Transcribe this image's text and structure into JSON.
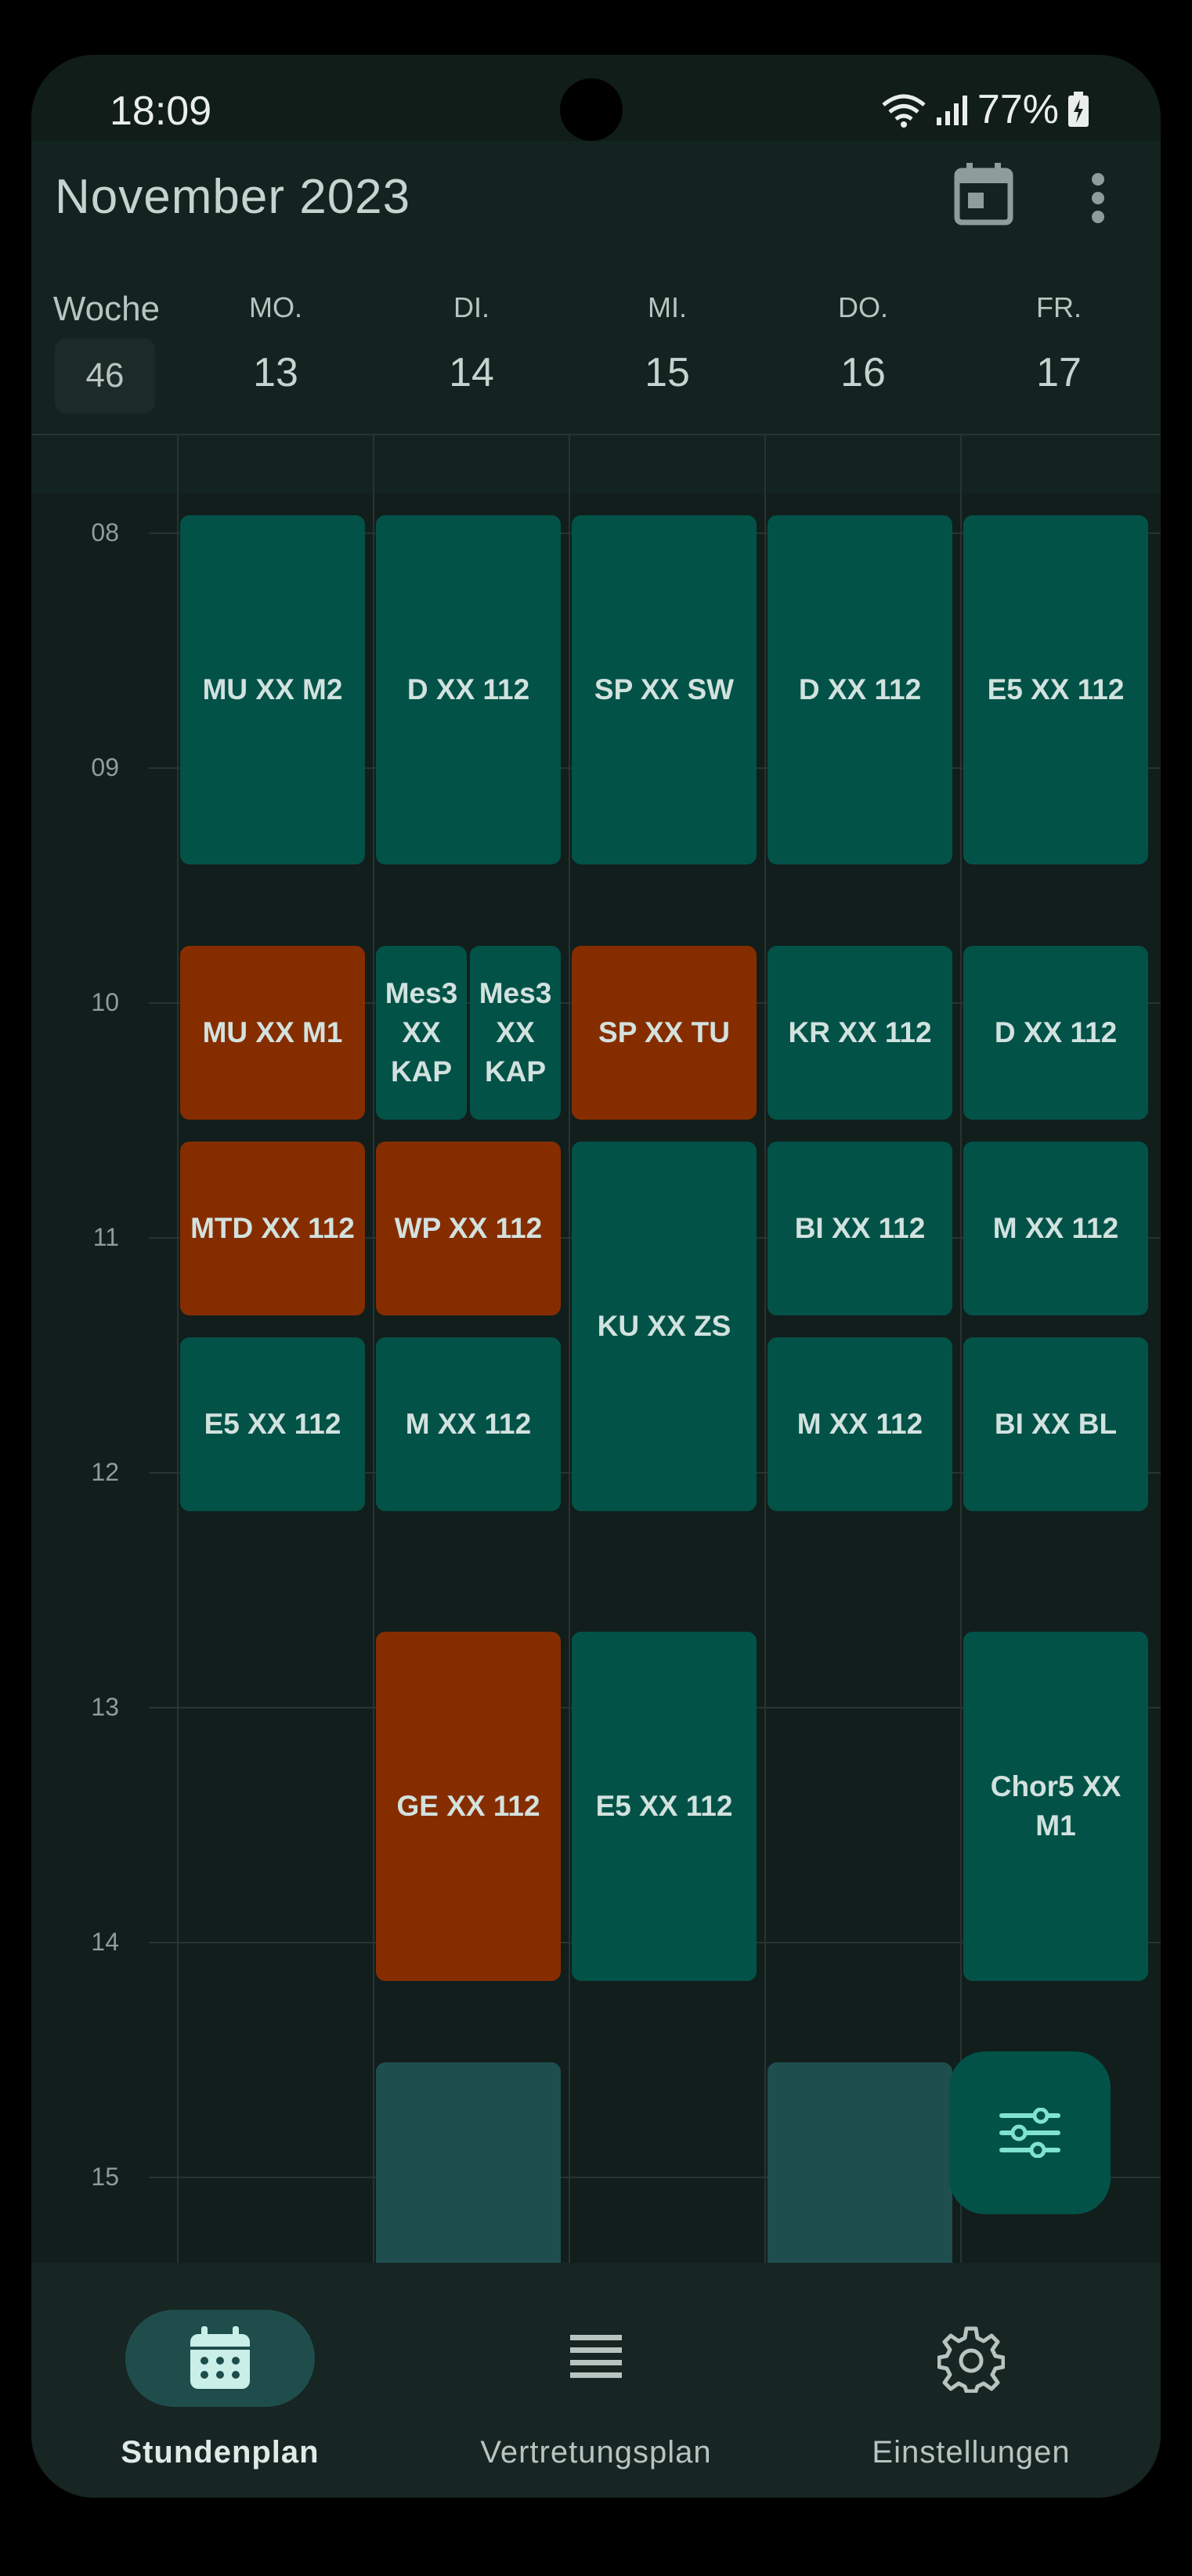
{
  "status": {
    "time": "18:09",
    "battery": "77%"
  },
  "header": {
    "title": "November 2023",
    "calendar_icon": "calendar-today-icon",
    "menu_icon": "more-vert-icon"
  },
  "week": {
    "label": "Woche",
    "number": "46"
  },
  "days": [
    {
      "name": "MO.",
      "date": "13"
    },
    {
      "name": "DI.",
      "date": "14"
    },
    {
      "name": "MI.",
      "date": "15"
    },
    {
      "name": "DO.",
      "date": "16"
    },
    {
      "name": "FR.",
      "date": "17"
    }
  ],
  "hours": [
    "08",
    "09",
    "10",
    "11",
    "12",
    "13",
    "14",
    "15"
  ],
  "lessons": {
    "mo1": "MU XX M2",
    "di1": "D XX 112",
    "mi1": "SP XX SW",
    "do1": "D XX 112",
    "fr1": "E5 XX 112",
    "mo2": "MU XX M1",
    "di2a": "Mes3 XX KAP",
    "di2b": "Mes3 XX KAP",
    "mi2": "SP XX TU",
    "do2": "KR XX 112",
    "fr2": "D XX 112",
    "mo3": "MTD XX 112",
    "di3": "WP XX 112",
    "mi3": "KU XX ZS",
    "do3": "BI XX 112",
    "fr3": "M XX 112",
    "mo4": "E5 XX 112",
    "di4": "M XX 112",
    "do4": "M XX 112",
    "fr4": "BI XX BL",
    "di5": "GE XX 112",
    "mi5": "E5 XX 112",
    "fr5": "Chor5 XX M1"
  },
  "colors": {
    "regular": "#025248",
    "changed": "#862d00",
    "upcoming": "#1f4e4f"
  },
  "nav": [
    {
      "label": "Stundenplan",
      "icon": "calendar-icon",
      "active": true
    },
    {
      "label": "Vertretungsplan",
      "icon": "list-icon",
      "active": false
    },
    {
      "label": "Einstellungen",
      "icon": "gear-icon",
      "active": false
    }
  ],
  "fab": {
    "icon": "filter-sliders-icon"
  }
}
